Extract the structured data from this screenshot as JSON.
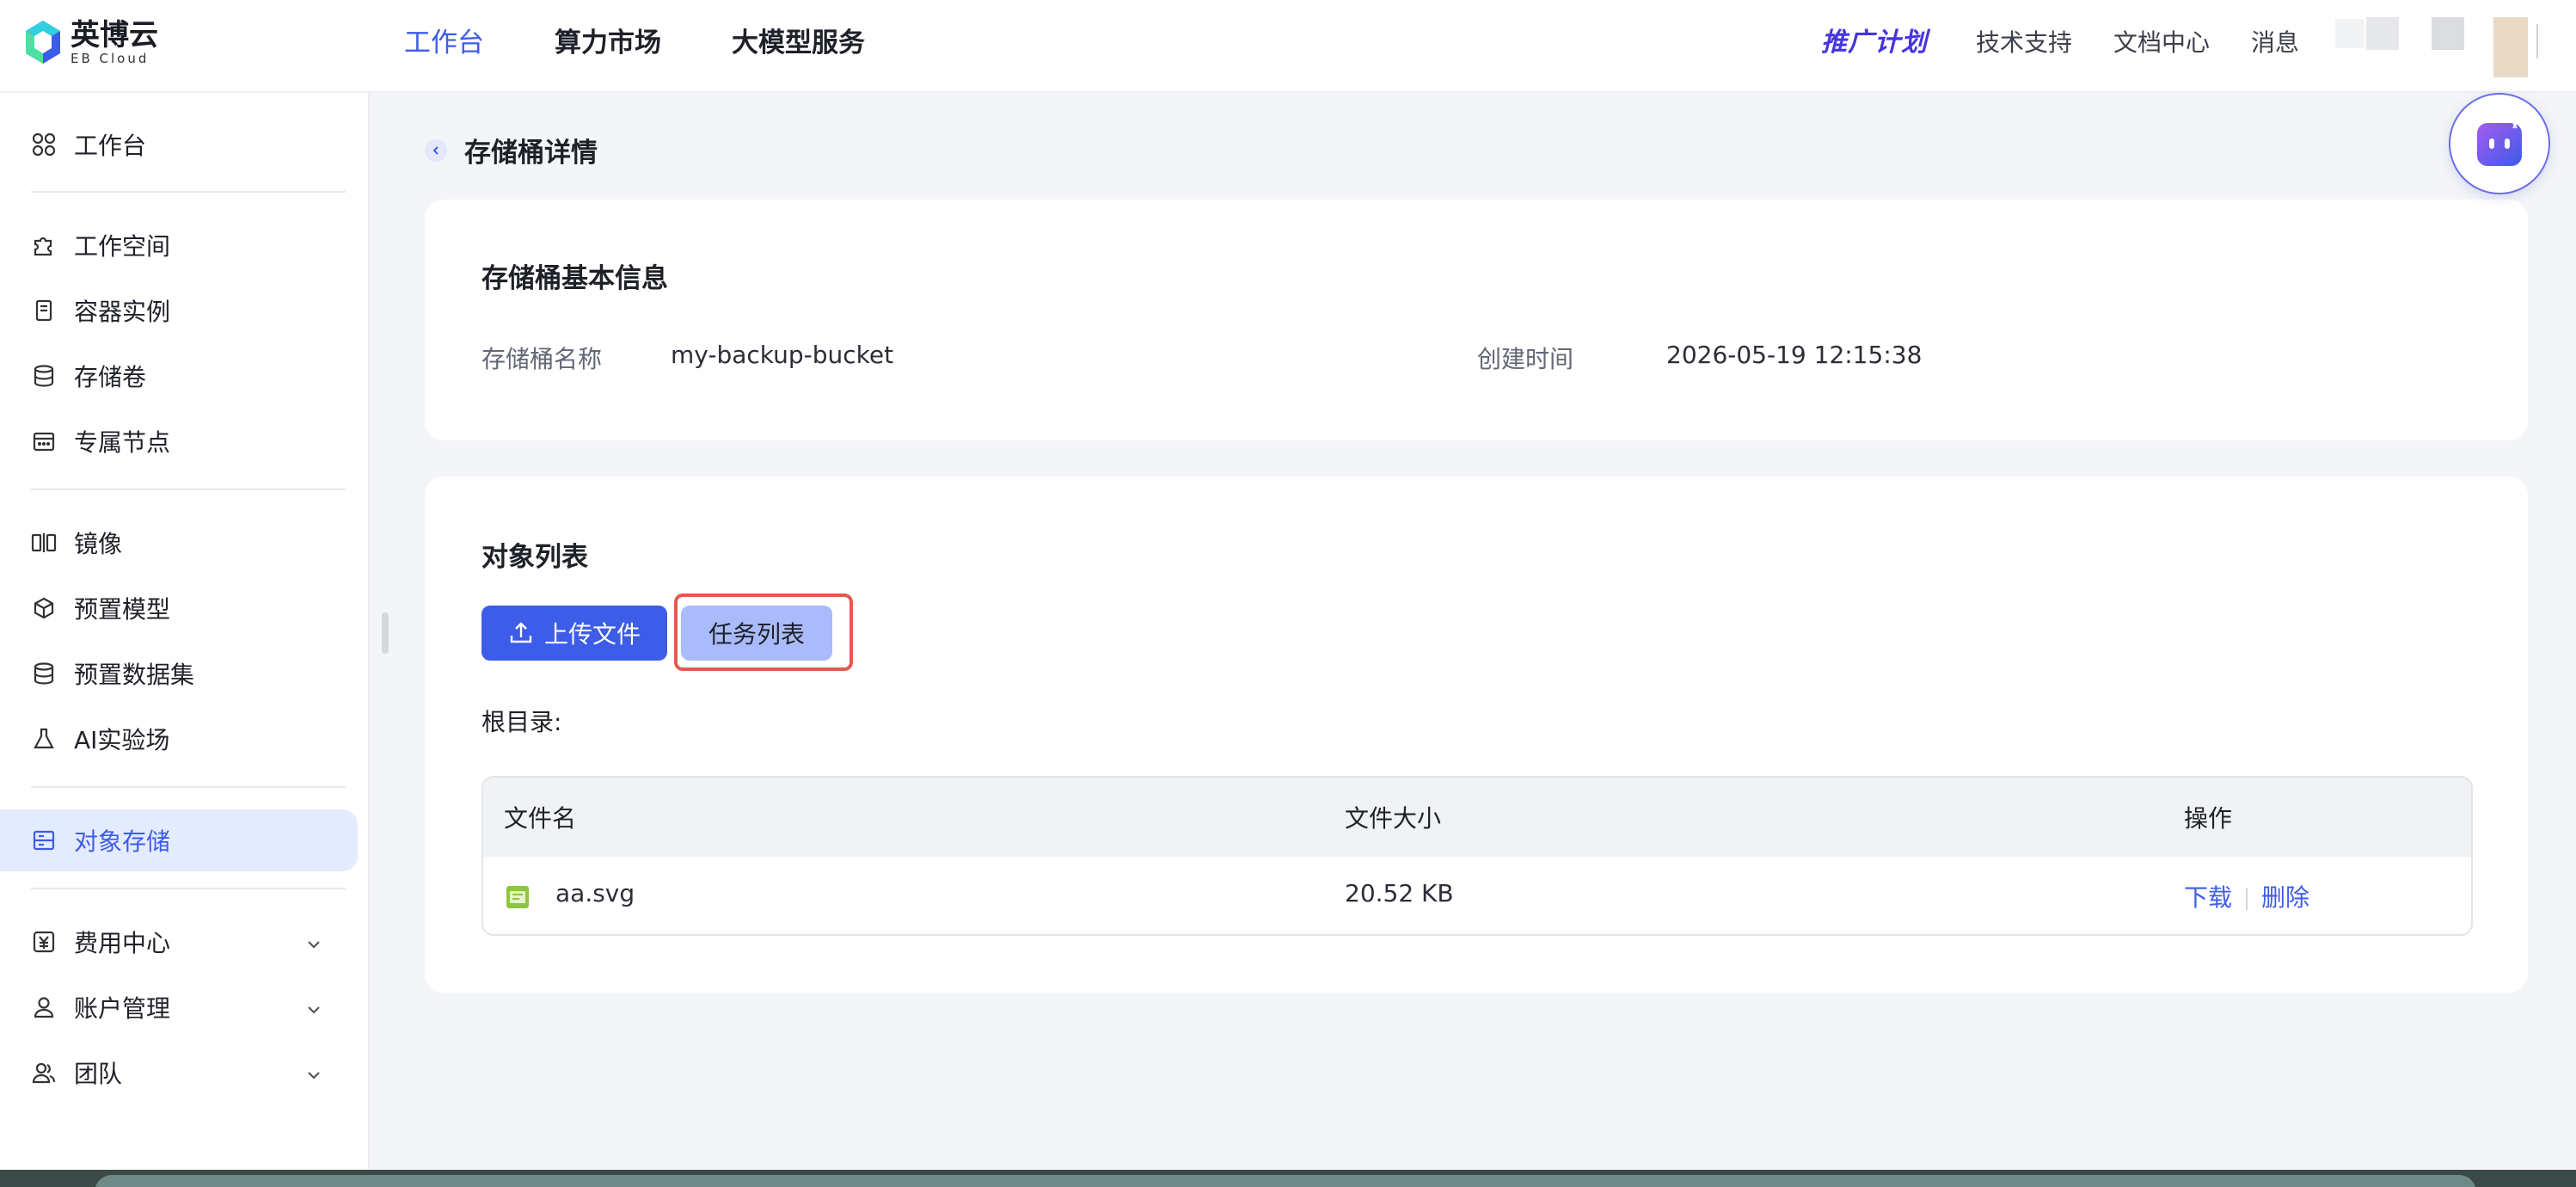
{
  "brand": {
    "name_cn": "英博云",
    "name_en": "EB Cloud"
  },
  "topnav": {
    "items": [
      {
        "label": "工作台",
        "active": true
      },
      {
        "label": "算力市场",
        "active": false
      },
      {
        "label": "大模型服务",
        "active": false
      }
    ],
    "promo": "推广计划",
    "right": [
      "技术支持",
      "文档中心",
      "消息"
    ]
  },
  "sidebar": {
    "items": [
      {
        "label": "工作台",
        "icon": "grid-icon"
      },
      {
        "label": "工作空间",
        "icon": "puzzle-icon"
      },
      {
        "label": "容器实例",
        "icon": "server-icon"
      },
      {
        "label": "存储卷",
        "icon": "database-icon"
      },
      {
        "label": "专属节点",
        "icon": "calendar-icon"
      },
      {
        "label": "镜像",
        "icon": "mirror-icon"
      },
      {
        "label": "预置模型",
        "icon": "cube-icon"
      },
      {
        "label": "预置数据集",
        "icon": "database-icon"
      },
      {
        "label": "AI实验场",
        "icon": "flask-icon"
      },
      {
        "label": "对象存储",
        "icon": "storage-icon",
        "active": true
      },
      {
        "label": "费用中心",
        "icon": "yen-icon",
        "expandable": true
      },
      {
        "label": "账户管理",
        "icon": "user-icon",
        "expandable": true
      },
      {
        "label": "团队",
        "icon": "team-icon",
        "expandable": true
      }
    ]
  },
  "page": {
    "title": "存储桶详情"
  },
  "basic_info": {
    "title": "存储桶基本信息",
    "bucket_name_label": "存储桶名称",
    "bucket_name_value": "my-backup-bucket",
    "created_label": "创建时间",
    "created_value": "2026-05-19 12:15:38"
  },
  "objects": {
    "title": "对象列表",
    "upload_label": "上传文件",
    "tasks_label": "任务列表",
    "root_label": "根目录:",
    "columns": [
      "文件名",
      "文件大小",
      "操作"
    ],
    "rows": [
      {
        "name": "aa.svg",
        "size": "20.52 KB",
        "actions": [
          "下载",
          "删除"
        ]
      }
    ]
  },
  "colors": {
    "accent": "#3d5ce8",
    "highlight_border": "#e15b4f",
    "secondary_button": "#a9bbfb"
  }
}
